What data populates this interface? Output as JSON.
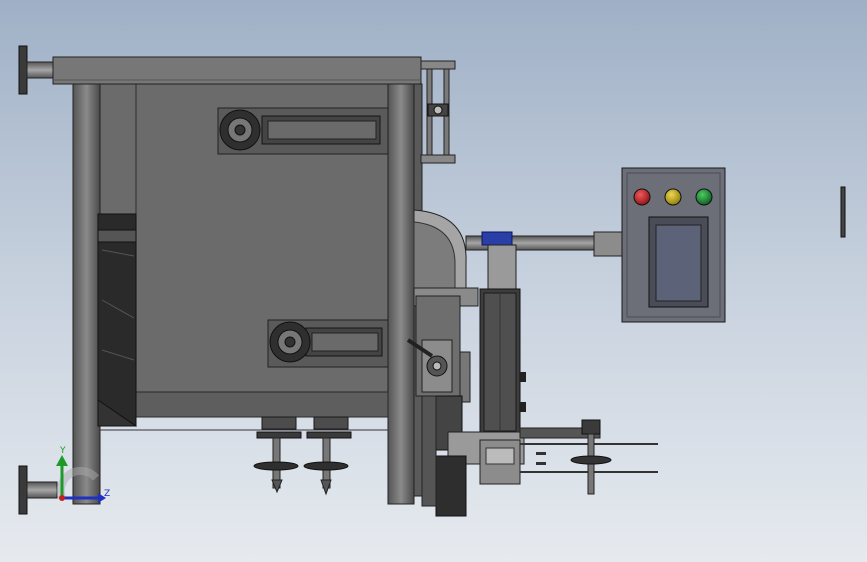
{
  "colors": {
    "background_top": "#9fb0c6",
    "background_bottom": "#e6eaef",
    "frame": "#6b6b6b",
    "panel": "#6a6a6a",
    "panel_dark": "#4a4a4a",
    "outline": "#222222",
    "steel_light": "#9a9a9a",
    "control_box": "#6c6f78",
    "screen": "#5c6278",
    "lamp_red": "#c2242a",
    "lamp_yellow": "#c7b318",
    "lamp_green": "#1d8a33",
    "blue_clamp": "#2a3ea8",
    "axis_x": "#c42020",
    "axis_y": "#1f9a2a",
    "axis_z": "#2030c0"
  },
  "axes": {
    "y_label": "Y",
    "z_label": "Z"
  },
  "control_panel": {
    "lamps": [
      "red",
      "yellow",
      "green"
    ]
  }
}
